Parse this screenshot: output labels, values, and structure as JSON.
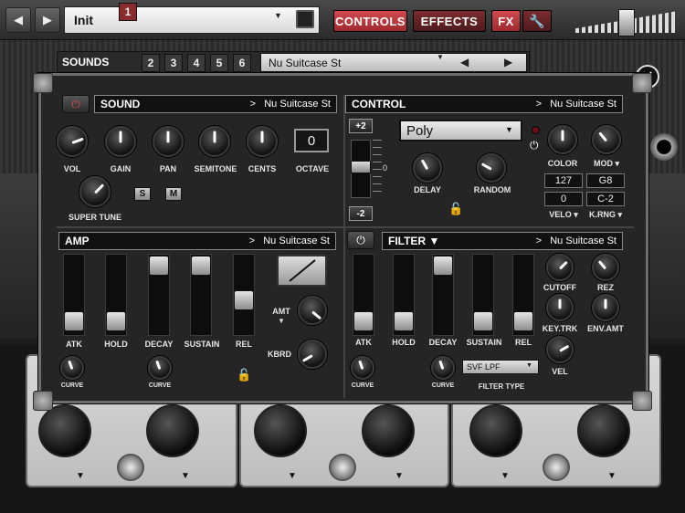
{
  "toolbar": {
    "preset_name": "Init",
    "controls_label": "CONTROLS",
    "effects_label": "EFFECTS",
    "fx_label": "FX"
  },
  "sounds_bar": {
    "label": "SOUNDS",
    "slots": [
      "1",
      "2",
      "3",
      "4",
      "5",
      "6"
    ],
    "active_slot": "1",
    "preset": "Nu Suitcase St"
  },
  "sound": {
    "title": "SOUND",
    "preset": "Nu Suitcase St",
    "knobs": [
      "VOL",
      "GAIN",
      "PAN",
      "SEMITONE",
      "CENTS"
    ],
    "octave_label": "OCTAVE",
    "octave_value": "0",
    "super_tune_label": "SUPER TUNE",
    "s_label": "S",
    "m_label": "M"
  },
  "control": {
    "title": "CONTROL",
    "preset": "Nu Suitcase St",
    "plus2": "+2",
    "minus2": "-2",
    "bend_zero": "0",
    "mode": "Poly",
    "delay_label": "DELAY",
    "random_label": "RANDOM",
    "color_label": "COLOR",
    "mod_label": "MOD",
    "velo_hi": "127",
    "velo_lo": "0",
    "krng_hi": "G8",
    "krng_lo": "C-2",
    "velo_label": "VELO",
    "krng_label": "K.RNG"
  },
  "amp": {
    "title": "AMP",
    "preset": "Nu Suitcase St",
    "sliders": [
      "ATK",
      "HOLD",
      "DECAY",
      "SUSTAIN",
      "REL"
    ],
    "amt_label": "AMT",
    "kbrd_label": "KBRD",
    "curve1": "CURVE",
    "curve2": "CURVE"
  },
  "filter": {
    "title": "FILTER",
    "preset": "Nu Suitcase St",
    "sliders": [
      "ATK",
      "HOLD",
      "DECAY",
      "SUSTAIN",
      "REL"
    ],
    "cutoff_label": "CUTOFF",
    "rez_label": "REZ",
    "keytrk_label": "KEY.TRK",
    "envamt_label": "ENV.AMT",
    "vel_label": "VEL",
    "type_value": "SVF LPF",
    "type_label": "FILTER TYPE",
    "curve1": "CURVE",
    "curve2": "CURVE"
  },
  "colors": {
    "accent_red": "#b8363b",
    "panel": "#252525"
  },
  "icons": [
    "prev-icon",
    "next-icon",
    "save-icon",
    "wrench-icon",
    "close-icon",
    "power-icon",
    "lock-icon"
  ]
}
